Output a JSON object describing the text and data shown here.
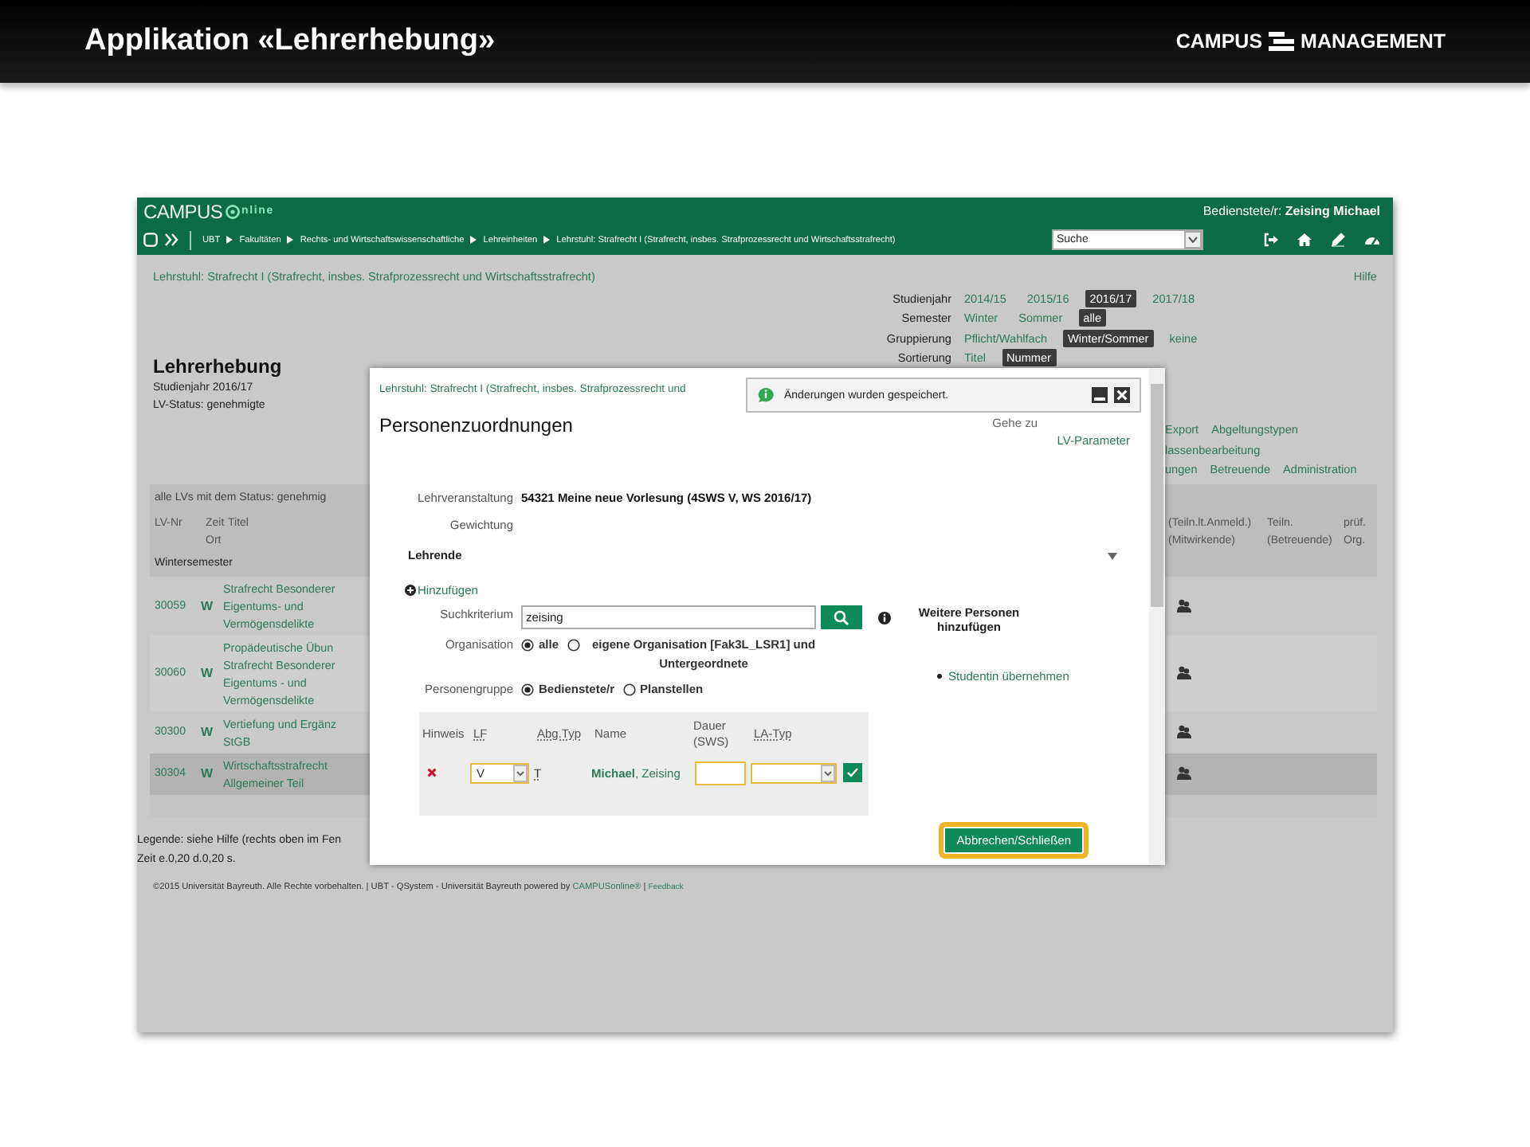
{
  "slide": {
    "title": "Applikation «Lehrerhebung»",
    "logo": [
      "CAMPUS",
      "MANAGEMENT"
    ]
  },
  "app": {
    "logo": {
      "name": "CAMPUS",
      "tail": "nline"
    },
    "user": "Bedienstete/r: **Zeising Michael**",
    "breadcrumbs": [
      "UBT",
      "Fakultäten",
      "Rechts- und Wirtschaftswissenschaftliche",
      "Lehreinheiten",
      "Lehrstuhl: Strafrecht I (Strafrecht, insbes. Strafprozessrecht und Wirtschaftsstrafrecht)"
    ],
    "search_select": "Suche"
  },
  "page": {
    "org_title": "Lehrstuhl: Strafrecht I (Strafrecht, insbes. Strafprozessrecht und Wirtschaftsstrafrecht)",
    "help": "Hilfe",
    "filters": [
      {
        "label": "Studienjahr",
        "options": [
          {
            "label": "2014/15",
            "selected": false
          },
          {
            "label": "2015/16",
            "selected": false
          },
          {
            "label": "2016/17",
            "selected": true
          },
          {
            "label": "2017/18",
            "selected": false
          }
        ]
      },
      {
        "label": "Semester",
        "options": [
          {
            "label": "Winter",
            "selected": false
          },
          {
            "label": "Sommer",
            "selected": false
          },
          {
            "label": "alle",
            "selected": true
          }
        ]
      },
      {
        "label": "Gruppierung",
        "options": [
          {
            "label": "Pflicht/Wahlfach",
            "selected": false
          },
          {
            "label": "Winter/Sommer",
            "selected": true
          },
          {
            "label": "keine",
            "selected": false
          }
        ]
      },
      {
        "label": "Sortierung",
        "options": [
          {
            "label": "Titel",
            "selected": false
          },
          {
            "label": "Nummer",
            "selected": true
          }
        ]
      }
    ],
    "heading": "Lehrerhebung",
    "info": [
      "Studienjahr 2016/17",
      "LV-Status: genehmigte"
    ],
    "links": [
      [
        "Export",
        "Abgeltungstypen"
      ],
      [
        "lassenbearbeitung"
      ],
      [
        "ungen",
        "Betreuende",
        "Administration"
      ]
    ]
  },
  "table": {
    "caption": "alle LVs mit dem Status: genehmig",
    "columns": [
      "LV-Nr",
      "Zeit Ort",
      "Titel",
      "(Teiln.lt.Anmeld.) (Mitwirkende)",
      "Teiln. (Betreuende)",
      "prüf. Org."
    ],
    "group": "Wintersemester",
    "rows": [
      {
        "nr": "30059",
        "zeit": "W",
        "title": [
          "Strafrecht Besonderer",
          "Eigentums- und",
          "Vermögensdelikte"
        ],
        "selected": false
      },
      {
        "nr": "30060",
        "zeit": "W",
        "title": [
          "Propädeutische Übun",
          "Strafrecht Besonderer",
          "Eigentums - und",
          "Vermögensdelikte"
        ],
        "selected": false
      },
      {
        "nr": "30300",
        "zeit": "W",
        "title": [
          "Vertiefung und Ergänz",
          "StGB"
        ],
        "selected": false
      },
      {
        "nr": "30304",
        "zeit": "W",
        "title": [
          "Wirtschaftsstrafrecht",
          "Allgemeiner Teil"
        ],
        "selected": true
      }
    ]
  },
  "legend": [
    "Legende: siehe Hilfe (rechts oben im Fen",
    "Zeit e.0,20 d.0,20 s."
  ],
  "footer": {
    "text": "©2015 Universität Bayreuth. Alle Rechte vorbehalten. | UBT - QSystem - Universität Bayreuth powered by",
    "link": "CAMPUSonline®",
    "sep": "|",
    "feedback": "Feedback"
  },
  "dialog": {
    "org_title": "Lehrstuhl: Strafrecht I (Strafrecht, insbes. Strafprozessrecht und",
    "title": "Personenzuordnungen",
    "goto": "Gehe zu",
    "lv_parameter": "LV-Parameter",
    "toast": "Änderungen wurden gespeichert.",
    "fields": [
      {
        "label": "Lehrveranstaltung",
        "value": "54321 Meine neue Vorlesung (4SWS V, WS 2016/17)"
      },
      {
        "label": "Gewichtung"
      }
    ],
    "section": {
      "title": "Lehrende",
      "expanded": true
    },
    "add": "Hinzufügen",
    "search": {
      "label": "Suchkriterium",
      "value": "zeising"
    },
    "radios": [
      {
        "label": "Organisation",
        "options": [
          {
            "label": "alle",
            "selected": true
          },
          {
            "label": "eigene Organisation [Fak3L_LSR1] und Untergeordnete",
            "selected": false
          }
        ]
      },
      {
        "label": "Personengruppe",
        "options": [
          {
            "label": "Bedienstete/r",
            "selected": true
          },
          {
            "label": "Planstellen",
            "selected": false
          }
        ]
      }
    ],
    "side": {
      "title": "Weitere Personen hinzufügen",
      "links": [
        "Studentin übernehmen"
      ]
    },
    "table": {
      "columns": [
        {
          "label": "Hinweis",
          "abbr": false
        },
        {
          "label": "LF",
          "abbr": true
        },
        {
          "label": "Abg.Typ",
          "abbr": true
        },
        {
          "label": "Name",
          "abbr": false
        },
        {
          "label": "Dauer (SWS)",
          "abbr": false
        },
        {
          "label": "LA-Typ",
          "abbr": true
        }
      ],
      "rows": [
        {
          "lf": "V",
          "abg_typ": "T",
          "name": "**Michael**, Zeising"
        }
      ]
    },
    "button": {
      "label": "Abbrechen/Schließen",
      "focused": true
    }
  }
}
